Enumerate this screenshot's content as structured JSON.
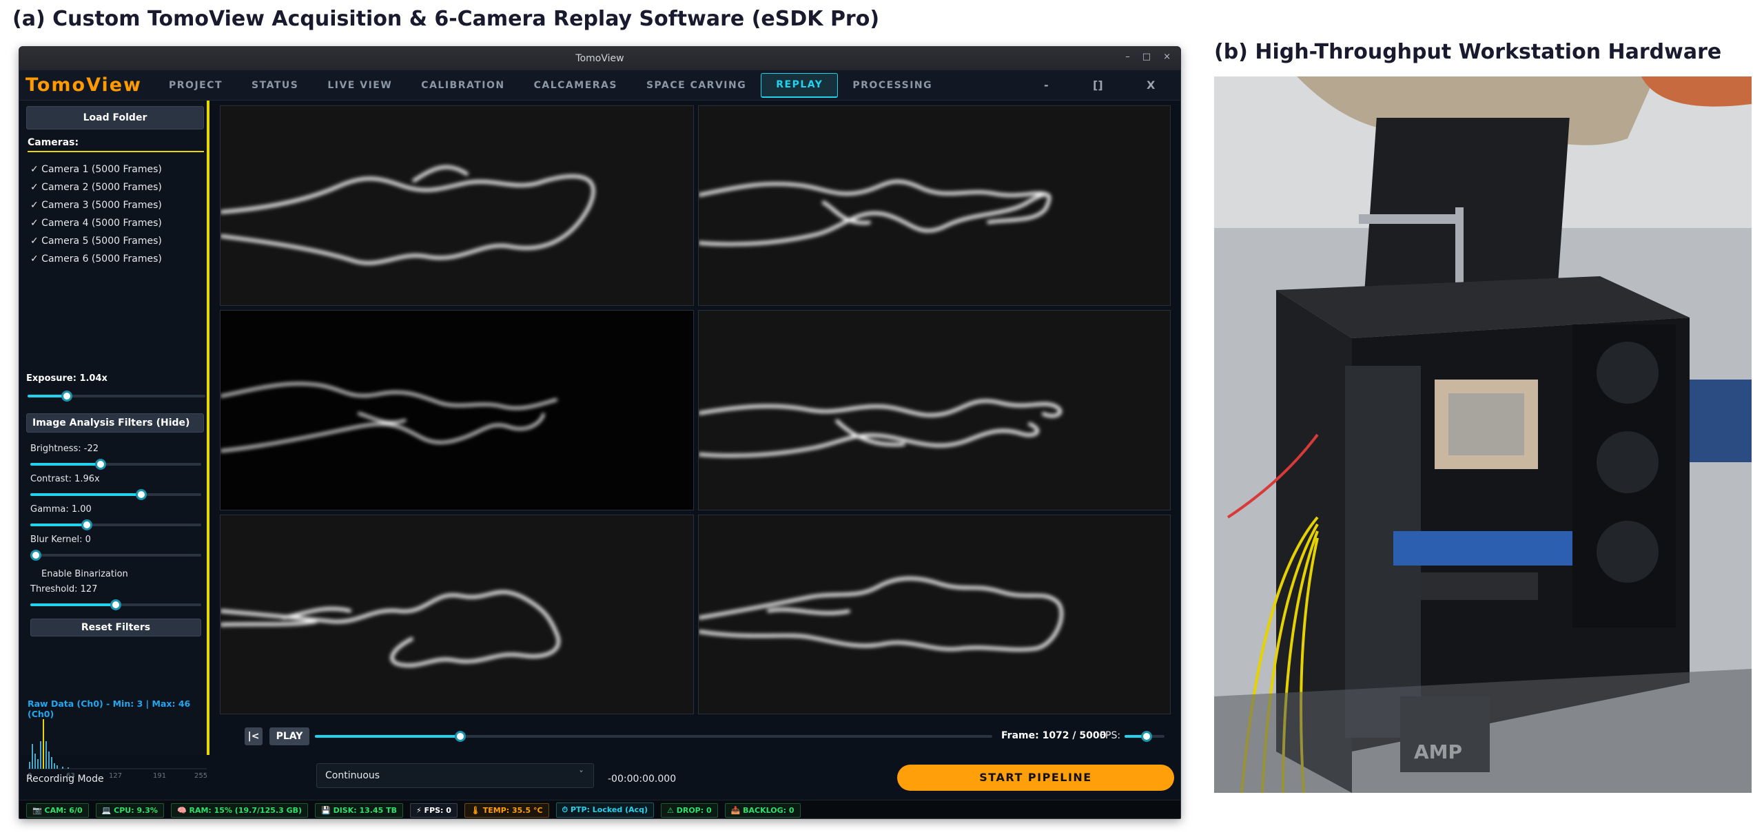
{
  "captions": {
    "a": "(a) Custom TomoView Acquisition & 6-Camera Replay Software (eSDK Pro)",
    "b": "(b) High-Throughput Workstation Hardware"
  },
  "window": {
    "title": "TomoView",
    "controls": [
      "–",
      "□",
      "×"
    ]
  },
  "menubar": {
    "logo": "TomoView",
    "tabs": [
      "PROJECT",
      "STATUS",
      "LIVE VIEW",
      "CALIBRATION",
      "CALCAMERAS",
      "SPACE CARVING",
      "REPLAY",
      "PROCESSING"
    ],
    "active_tab": "REPLAY",
    "controls": {
      "minimize": "-",
      "maximize": "[]",
      "close": "X"
    }
  },
  "sidebar": {
    "load_folder": "Load Folder",
    "cameras_label": "Cameras:",
    "cameras": [
      "✓ Camera 1 (5000 Frames)",
      "✓ Camera 2 (5000 Frames)",
      "✓ Camera 3 (5000 Frames)",
      "✓ Camera 4 (5000 Frames)",
      "✓ Camera 5 (5000 Frames)",
      "✓ Camera 6 (5000 Frames)"
    ],
    "exposure": {
      "label": "Exposure: 1.04x",
      "level": 0.22
    },
    "filters_toggle": "Image Analysis Filters (Hide)",
    "filters": {
      "brightness": {
        "label": "Brightness: -22",
        "level": 0.41
      },
      "contrast": {
        "label": "Contrast: 1.96x",
        "level": 0.65
      },
      "gamma": {
        "label": "Gamma: 1.00",
        "level": 0.33
      },
      "blur": {
        "label": "Blur Kernel: 0",
        "level": 0.0
      },
      "binarization": "Enable Binarization",
      "threshold": {
        "label": "Threshold: 127",
        "level": 0.5
      }
    },
    "reset_filters": "Reset Filters",
    "histogram": {
      "title": "Raw Data (Ch0) - Min: 3 | Max: 46 (Ch0)",
      "ticks": [
        "0",
        "63",
        "127",
        "191",
        "255"
      ]
    }
  },
  "replay": {
    "rewind": "|<",
    "play": "PLAY",
    "progress": 0.2144,
    "frame": "Frame: 1072 / 5000",
    "fps_label": "FPS:",
    "fps_level": 0.55
  },
  "recording": {
    "mode_label": "Recording Mode",
    "mode_value": "Continuous",
    "time": "-00:00:00.000",
    "start_button": "START PIPELINE"
  },
  "statusbar": [
    {
      "text": "📷 CAM: 6/0",
      "style": "green"
    },
    {
      "text": "💻 CPU: 9.3%",
      "style": "green"
    },
    {
      "text": "🧠 RAM: 15% (19.7/125.3 GB)",
      "style": "green"
    },
    {
      "text": "💾 DISK: 13.45 TB",
      "style": "green"
    },
    {
      "text": "⚡ FPS: 0",
      "style": "white"
    },
    {
      "text": "🌡 TEMP: 35.5 °C",
      "style": "orange"
    },
    {
      "text": "⏱ PTP: Locked (Acq)",
      "style": "cyan"
    },
    {
      "text": "⚠ DROP: 0",
      "style": "green"
    },
    {
      "text": "📥 BACKLOG: 0",
      "style": "green"
    }
  ],
  "colors": {
    "accent": "#22d3ee",
    "logo": "#ff9a00",
    "sidebar_border": "#e6d800",
    "start_button": "#ff9f0a"
  }
}
